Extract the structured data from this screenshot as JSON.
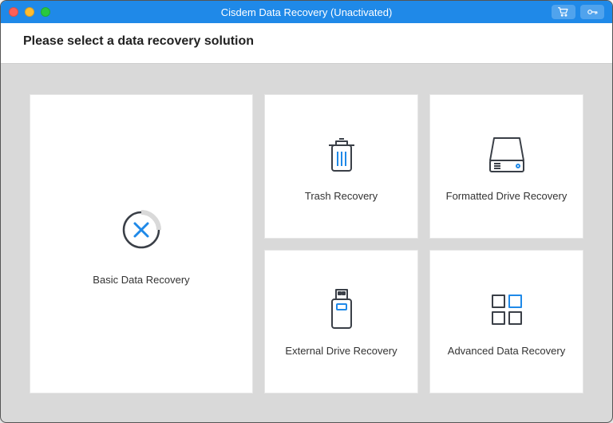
{
  "window": {
    "title": "Cisdem Data Recovery (Unactivated)"
  },
  "heading": "Please select a data recovery solution",
  "cards": {
    "basic": {
      "label": "Basic Data Recovery"
    },
    "trash": {
      "label": "Trash Recovery"
    },
    "formatted": {
      "label": "Formatted Drive Recovery"
    },
    "external": {
      "label": "External Drive Recovery"
    },
    "advanced": {
      "label": "Advanced Data Recovery"
    }
  },
  "colors": {
    "accent": "#1f89e8",
    "stroke": "#3a3f47"
  }
}
